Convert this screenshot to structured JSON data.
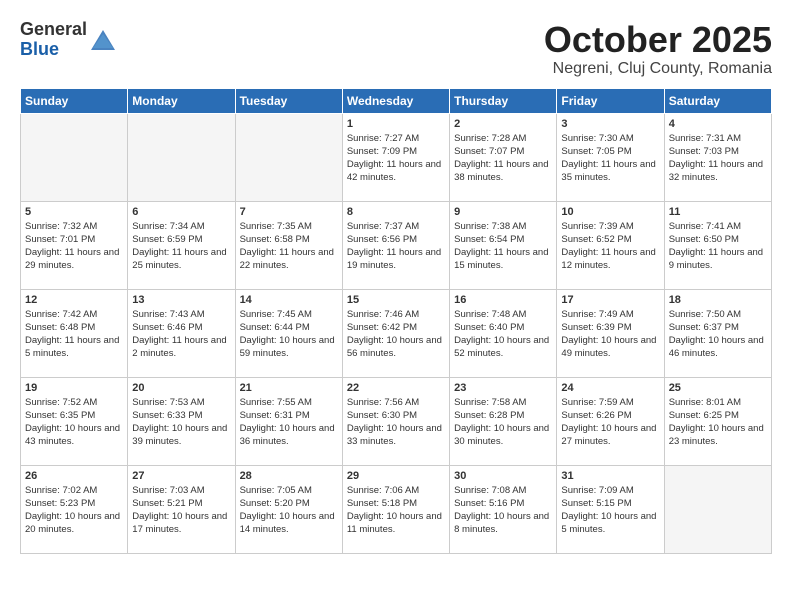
{
  "header": {
    "logo_general": "General",
    "logo_blue": "Blue",
    "month_title": "October 2025",
    "subtitle": "Negreni, Cluj County, Romania"
  },
  "days_of_week": [
    "Sunday",
    "Monday",
    "Tuesday",
    "Wednesday",
    "Thursday",
    "Friday",
    "Saturday"
  ],
  "weeks": [
    [
      {
        "num": "",
        "content": "",
        "empty": true
      },
      {
        "num": "",
        "content": "",
        "empty": true
      },
      {
        "num": "",
        "content": "",
        "empty": true
      },
      {
        "num": "1",
        "content": "Sunrise: 7:27 AM\nSunset: 7:09 PM\nDaylight: 11 hours and 42 minutes.",
        "empty": false
      },
      {
        "num": "2",
        "content": "Sunrise: 7:28 AM\nSunset: 7:07 PM\nDaylight: 11 hours and 38 minutes.",
        "empty": false
      },
      {
        "num": "3",
        "content": "Sunrise: 7:30 AM\nSunset: 7:05 PM\nDaylight: 11 hours and 35 minutes.",
        "empty": false
      },
      {
        "num": "4",
        "content": "Sunrise: 7:31 AM\nSunset: 7:03 PM\nDaylight: 11 hours and 32 minutes.",
        "empty": false
      }
    ],
    [
      {
        "num": "5",
        "content": "Sunrise: 7:32 AM\nSunset: 7:01 PM\nDaylight: 11 hours and 29 minutes.",
        "empty": false
      },
      {
        "num": "6",
        "content": "Sunrise: 7:34 AM\nSunset: 6:59 PM\nDaylight: 11 hours and 25 minutes.",
        "empty": false
      },
      {
        "num": "7",
        "content": "Sunrise: 7:35 AM\nSunset: 6:58 PM\nDaylight: 11 hours and 22 minutes.",
        "empty": false
      },
      {
        "num": "8",
        "content": "Sunrise: 7:37 AM\nSunset: 6:56 PM\nDaylight: 11 hours and 19 minutes.",
        "empty": false
      },
      {
        "num": "9",
        "content": "Sunrise: 7:38 AM\nSunset: 6:54 PM\nDaylight: 11 hours and 15 minutes.",
        "empty": false
      },
      {
        "num": "10",
        "content": "Sunrise: 7:39 AM\nSunset: 6:52 PM\nDaylight: 11 hours and 12 minutes.",
        "empty": false
      },
      {
        "num": "11",
        "content": "Sunrise: 7:41 AM\nSunset: 6:50 PM\nDaylight: 11 hours and 9 minutes.",
        "empty": false
      }
    ],
    [
      {
        "num": "12",
        "content": "Sunrise: 7:42 AM\nSunset: 6:48 PM\nDaylight: 11 hours and 5 minutes.",
        "empty": false
      },
      {
        "num": "13",
        "content": "Sunrise: 7:43 AM\nSunset: 6:46 PM\nDaylight: 11 hours and 2 minutes.",
        "empty": false
      },
      {
        "num": "14",
        "content": "Sunrise: 7:45 AM\nSunset: 6:44 PM\nDaylight: 10 hours and 59 minutes.",
        "empty": false
      },
      {
        "num": "15",
        "content": "Sunrise: 7:46 AM\nSunset: 6:42 PM\nDaylight: 10 hours and 56 minutes.",
        "empty": false
      },
      {
        "num": "16",
        "content": "Sunrise: 7:48 AM\nSunset: 6:40 PM\nDaylight: 10 hours and 52 minutes.",
        "empty": false
      },
      {
        "num": "17",
        "content": "Sunrise: 7:49 AM\nSunset: 6:39 PM\nDaylight: 10 hours and 49 minutes.",
        "empty": false
      },
      {
        "num": "18",
        "content": "Sunrise: 7:50 AM\nSunset: 6:37 PM\nDaylight: 10 hours and 46 minutes.",
        "empty": false
      }
    ],
    [
      {
        "num": "19",
        "content": "Sunrise: 7:52 AM\nSunset: 6:35 PM\nDaylight: 10 hours and 43 minutes.",
        "empty": false
      },
      {
        "num": "20",
        "content": "Sunrise: 7:53 AM\nSunset: 6:33 PM\nDaylight: 10 hours and 39 minutes.",
        "empty": false
      },
      {
        "num": "21",
        "content": "Sunrise: 7:55 AM\nSunset: 6:31 PM\nDaylight: 10 hours and 36 minutes.",
        "empty": false
      },
      {
        "num": "22",
        "content": "Sunrise: 7:56 AM\nSunset: 6:30 PM\nDaylight: 10 hours and 33 minutes.",
        "empty": false
      },
      {
        "num": "23",
        "content": "Sunrise: 7:58 AM\nSunset: 6:28 PM\nDaylight: 10 hours and 30 minutes.",
        "empty": false
      },
      {
        "num": "24",
        "content": "Sunrise: 7:59 AM\nSunset: 6:26 PM\nDaylight: 10 hours and 27 minutes.",
        "empty": false
      },
      {
        "num": "25",
        "content": "Sunrise: 8:01 AM\nSunset: 6:25 PM\nDaylight: 10 hours and 23 minutes.",
        "empty": false
      }
    ],
    [
      {
        "num": "26",
        "content": "Sunrise: 7:02 AM\nSunset: 5:23 PM\nDaylight: 10 hours and 20 minutes.",
        "empty": false
      },
      {
        "num": "27",
        "content": "Sunrise: 7:03 AM\nSunset: 5:21 PM\nDaylight: 10 hours and 17 minutes.",
        "empty": false
      },
      {
        "num": "28",
        "content": "Sunrise: 7:05 AM\nSunset: 5:20 PM\nDaylight: 10 hours and 14 minutes.",
        "empty": false
      },
      {
        "num": "29",
        "content": "Sunrise: 7:06 AM\nSunset: 5:18 PM\nDaylight: 10 hours and 11 minutes.",
        "empty": false
      },
      {
        "num": "30",
        "content": "Sunrise: 7:08 AM\nSunset: 5:16 PM\nDaylight: 10 hours and 8 minutes.",
        "empty": false
      },
      {
        "num": "31",
        "content": "Sunrise: 7:09 AM\nSunset: 5:15 PM\nDaylight: 10 hours and 5 minutes.",
        "empty": false
      },
      {
        "num": "",
        "content": "",
        "empty": true
      }
    ]
  ]
}
